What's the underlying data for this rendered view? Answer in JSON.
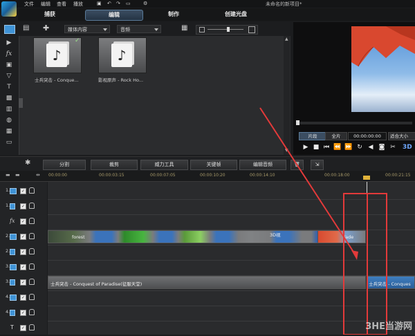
{
  "menubar": {
    "items": [
      "文件",
      "编辑",
      "查看",
      "播放"
    ],
    "project_title": "未命名的新项目*"
  },
  "tabs": [
    "捕获",
    "编辑",
    "制作",
    "创建光盘"
  ],
  "library": {
    "filter": "媒体内容",
    "category": "音频",
    "items": [
      {
        "label": "士兵突击 - Conque...",
        "checked": true
      },
      {
        "label": "影视原声 - Rock Ho..."
      }
    ]
  },
  "preview": {
    "mode_clip": "片段",
    "mode_full": "全片",
    "timecode": "00:00:00:00",
    "fit": "适合大小",
    "mode_3d": "3D"
  },
  "timeline_toolbar": {
    "split": "分割",
    "crop": "裁剪",
    "power_tools": "威力工具",
    "keyframe": "关键帧",
    "edit_audio": "编辑音频"
  },
  "ruler": {
    "ticks": [
      "00:00:00",
      "00:00:03:15",
      "00:00:07:05",
      "00:00:10:20",
      "00:00:14:10",
      "00:00:18:00",
      "00:00:21:15"
    ]
  },
  "tracks": [
    {
      "num": "1."
    },
    {
      "num": "1."
    },
    {
      "num": ""
    },
    {
      "num": "2."
    },
    {
      "num": "2."
    },
    {
      "num": "3."
    },
    {
      "num": "3."
    },
    {
      "num": "4."
    },
    {
      "num": "4."
    },
    {
      "num": ""
    }
  ],
  "clips": {
    "video_first": "forest",
    "video_3d": "3D视",
    "video_last": "Fade",
    "audio_main": "士兵突击 - Conquest of Paradise(征服天堂)",
    "audio_tail": "士兵突击 - Conques"
  },
  "watermark": "3HE当游网",
  "colors": {
    "accent": "#3f93d6",
    "highlight": "#e33a3a"
  }
}
